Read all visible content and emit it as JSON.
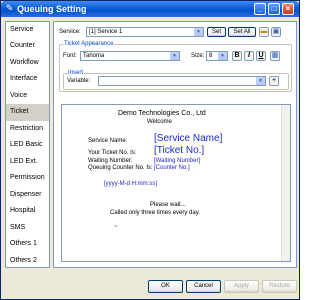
{
  "window": {
    "title": "Queuing Setting",
    "controls": {
      "minimize": "_",
      "maximize": "□",
      "close": "×"
    }
  },
  "nav": {
    "items": [
      {
        "label": "Service",
        "selected": false
      },
      {
        "label": "Counter",
        "selected": false
      },
      {
        "label": "Workflow",
        "selected": false
      },
      {
        "label": "Interface",
        "selected": false
      },
      {
        "label": "Voice",
        "selected": false
      },
      {
        "label": "Ticket",
        "selected": true
      },
      {
        "label": "Restriction",
        "selected": false
      },
      {
        "label": "LED Basic",
        "selected": false
      },
      {
        "label": "LED Ext.",
        "selected": false
      },
      {
        "label": "Permission",
        "selected": false
      },
      {
        "label": "Dispenser",
        "selected": false
      },
      {
        "label": "Hospital",
        "selected": false
      },
      {
        "label": "SMS",
        "selected": false
      },
      {
        "label": "Others 1",
        "selected": false
      },
      {
        "label": "Others 2",
        "selected": false
      }
    ]
  },
  "service": {
    "label": "Service:",
    "value": "[1] Service 1",
    "set_label": "Set",
    "set_all_label": "Set All"
  },
  "ticket_appearance": {
    "title": "Ticket Appearance",
    "font_label": "Font:",
    "font_value": "Tahoma",
    "size_label": "Size:",
    "size_value": "8",
    "bold": "B",
    "italic": "I",
    "underline": "U"
  },
  "insert": {
    "title": "Insert",
    "variable_label": "Variable:",
    "variable_value": "",
    "add_label": "+"
  },
  "ticket_preview": {
    "company": "Demo Technologies Co., Ltd",
    "welcome": "Welcome",
    "service_name_label": "Service Name:",
    "service_name_var": "[Service Name]",
    "ticket_no_label": "Your Ticket No. Is:",
    "ticket_no_var": "[Ticket No.]",
    "waiting_label": "Waiting Number:",
    "waiting_var": "[Waiting Number]",
    "queuing_counter_label": "Queuing Counter No. Is:",
    "queuing_counter_var": "[Counter No.]",
    "datetime_var": "[yyyy-M-d H:mm:ss]",
    "please_wait": "Please wait...",
    "called_only": "Called only three times every day.",
    "tilde": "~"
  },
  "footer": {
    "ok": "OK",
    "cancel": "Cancel",
    "apply": "Apply",
    "restore": "Restore"
  },
  "colors": {
    "title_bar": "#0a5fd8",
    "variable_text": "#1d28c9",
    "group_title": "#0046d5",
    "selected_nav": "#d4d0c8"
  }
}
